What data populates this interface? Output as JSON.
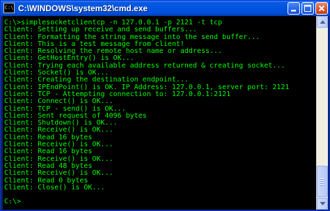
{
  "window": {
    "icon_glyph": "C:\\",
    "title": "C:\\WINDOWS\\system32\\cmd.exe"
  },
  "controls": {
    "minimize_icon": "minimize-icon",
    "maximize_icon": "maximize-icon",
    "close_icon": "close-icon"
  },
  "colors": {
    "console_background": "#000000",
    "console_text": "#00ff00",
    "titlebar": "#0054e3",
    "close_button": "#d6532c"
  },
  "console": {
    "lines": [
      "C:\\>simplesocketclientcp -n 127.0.0.1 -p 2121 -t tcp",
      "Client: Setting up receive and send buffers...",
      "Client: Formatting the string message into the send buffer...",
      "Client: This is a test message from client!",
      "Client: Resolving the remote host name or address...",
      "Client: GetHostEntry() is OK...",
      "Client: Trying each available address returned & creating socket...",
      "Client: Socket() is OK...",
      "Client: Creating the destination endpoint...",
      "Client: IPEndPoint() is OK. IP Address: 127.0.0.1, server port: 2121",
      "Client: TCP - Attempting connection to: 127.0.0.1:2121",
      "Client: Connect() is OK...",
      "Client: TCP - send() is OK...",
      "Client: Sent request of 4096 bytes",
      "Client: Shutdown() is OK...",
      "Client: Receive() is OK...",
      "Client: Read 16 bytes",
      "Client: Receive() is OK...",
      "Client: Read 16 bytes",
      "Client: Receive() is OK...",
      "Client: Read 48 bytes",
      "Client: Receive() is OK...",
      "Client: Read 0 bytes",
      "Client: Close() is OK...",
      "",
      "C:\\>"
    ]
  }
}
